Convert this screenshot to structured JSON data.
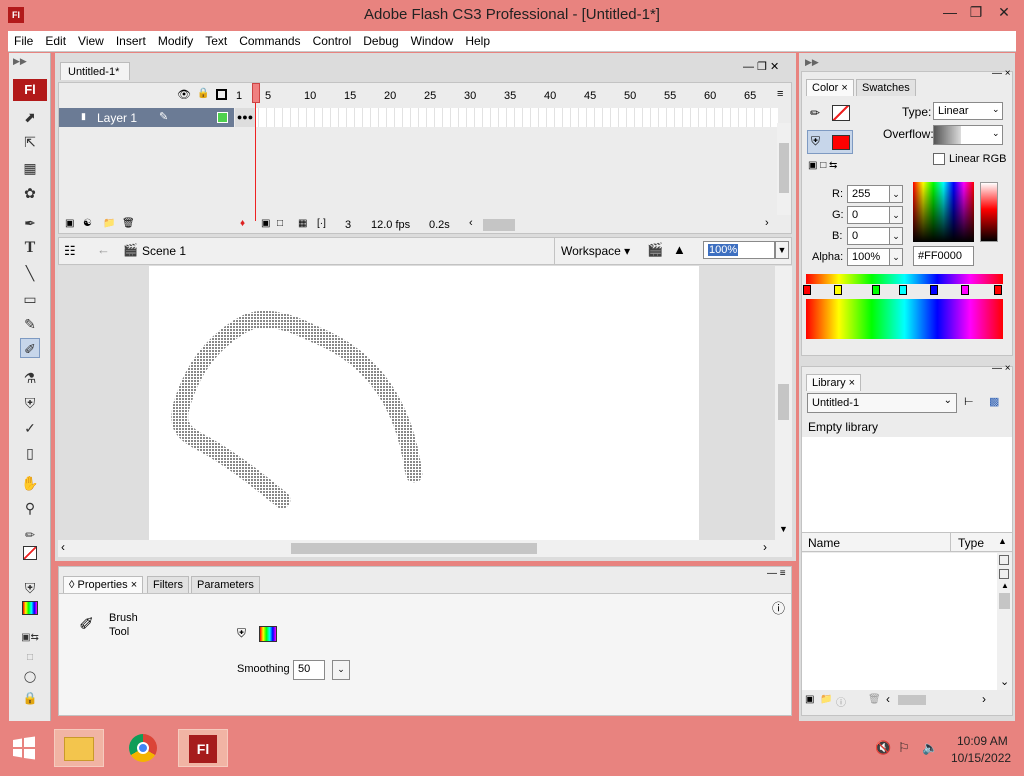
{
  "app": {
    "title": "Adobe Flash CS3 Professional - [Untitled-1*]",
    "icon_text": "Fl"
  },
  "menu": [
    "File",
    "Edit",
    "View",
    "Insert",
    "Modify",
    "Text",
    "Commands",
    "Control",
    "Debug",
    "Window",
    "Help"
  ],
  "tools": {
    "logo": "Fl",
    "selected": "brush-tool"
  },
  "document": {
    "tab": "Untitled-1*"
  },
  "timeline": {
    "frame_numbers": [
      "1",
      "5",
      "10",
      "15",
      "20",
      "25",
      "30",
      "35",
      "40",
      "45",
      "50",
      "55",
      "60",
      "65"
    ],
    "layer_name": "Layer 1",
    "current_frame": "3",
    "fps": "12.0 fps",
    "time": "0.2s"
  },
  "editbar": {
    "scene": "Scene 1",
    "workspace": "Workspace",
    "zoom": "100%"
  },
  "properties": {
    "tabs": [
      "Properties",
      "Filters",
      "Parameters"
    ],
    "tool_name_line1": "Brush",
    "tool_name_line2": "Tool",
    "smoothing_label": "Smoothing",
    "smoothing_value": "50"
  },
  "color": {
    "tabs": [
      "Color",
      "Swatches"
    ],
    "type_label": "Type:",
    "type_value": "Linear",
    "overflow_label": "Overflow:",
    "linear_rgb_label": "Linear RGB",
    "r_label": "R:",
    "r_value": "255",
    "g_label": "G:",
    "g_value": "0",
    "b_label": "B:",
    "b_value": "0",
    "alpha_label": "Alpha:",
    "alpha_value": "100%",
    "hex_value": "#FF0000",
    "fill_color": "#ff0000"
  },
  "library": {
    "tab": "Library",
    "document": "Untitled-1",
    "status": "Empty library",
    "col_name": "Name",
    "col_type": "Type"
  },
  "taskbar": {
    "time": "10:09 AM",
    "date": "10/15/2022",
    "flash_icon": "Fl"
  }
}
